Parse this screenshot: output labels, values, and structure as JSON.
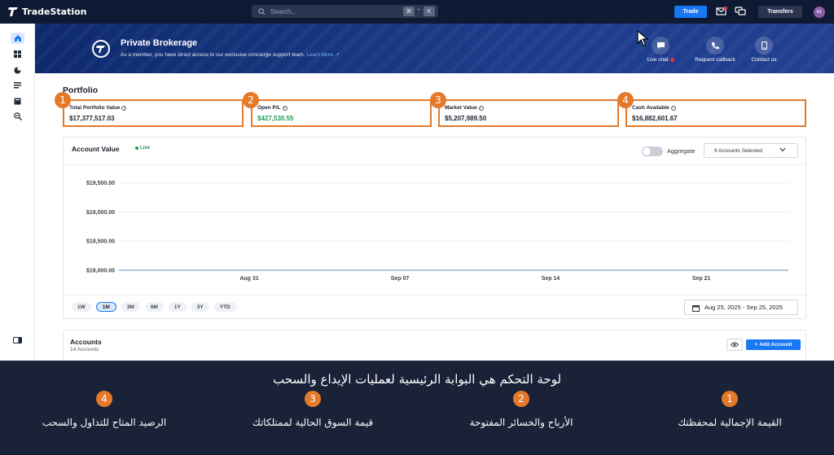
{
  "topbar": {
    "brand": "TradeStation",
    "search_placeholder": "Search...",
    "kbd_key1": "⌘",
    "kbd_plus": "+",
    "kbd_key2": "K",
    "trade_label": "Trade",
    "transfers_label": "Transfers",
    "avatar_initials": "ML"
  },
  "banner": {
    "title": "Private Brokerage",
    "subtitle": "As a member, you have direct access to our exclusive concierge support team.",
    "learn_more": "Learn More ↗",
    "actions": [
      {
        "label": "Live chat",
        "icon": "chat-icon"
      },
      {
        "label": "Request callback",
        "icon": "phone-icon"
      },
      {
        "label": "Contact us",
        "icon": "mobile-icon"
      }
    ]
  },
  "portfolio": {
    "title": "Portfolio",
    "stats": [
      {
        "badge": "1",
        "label": "Total Portfolio Value",
        "value": "$17,377,517.03",
        "green": false
      },
      {
        "badge": "2",
        "label": "Open P/L",
        "value": "$427,530.55",
        "green": true
      },
      {
        "badge": "3",
        "label": "Market Value",
        "value": "$5,207,989.50",
        "green": false
      },
      {
        "badge": "4",
        "label": "Cash Available",
        "value": "$16,882,601.67",
        "green": false
      }
    ]
  },
  "account_value": {
    "title": "Account Value",
    "live_label": "Live",
    "aggregate_label": "Aggregate",
    "accounts_selected": "9 Accounts Selected",
    "ranges": [
      "1W",
      "1M",
      "3M",
      "6M",
      "1Y",
      "3Y",
      "YTD"
    ],
    "active_range": "1M",
    "date_range": "Aug 25, 2025 - Sep 25, 2025"
  },
  "chart_data": {
    "type": "line",
    "title": "",
    "xlabel": "",
    "ylabel": "",
    "y_ticks": [
      18000,
      18500,
      19000,
      19500
    ],
    "y_tick_labels": [
      "$18,000.00",
      "$18,500.00",
      "$19,000.00",
      "$19,500.00"
    ],
    "ylim": [
      18000,
      19800
    ],
    "x_ticks": [
      "Aug 31",
      "Sep 07",
      "Sep 14",
      "Sep 21"
    ],
    "grid": true,
    "series": [
      {
        "values": [
          18000,
          18000
        ]
      }
    ]
  },
  "accounts": {
    "title": "Accounts",
    "count_label": "14 Accounts",
    "add_label": "Add Account"
  },
  "caption": {
    "title": "لوحة التحكم هي البوابة الرئيسية لعمليات الإيداع والسحب",
    "items": [
      {
        "badge": "1",
        "text": "القيمة الإجمالية لمحفظتك"
      },
      {
        "badge": "2",
        "text": "الأرباح والخسائر المفتوحة"
      },
      {
        "badge": "3",
        "text": "قيمة السوق الحالية لممتلكاتك"
      },
      {
        "badge": "4",
        "text": "الرصيد المتاح للتداول والسحب"
      }
    ]
  },
  "colors": {
    "accent": "#1877f2",
    "highlight": "#e4792a",
    "positive": "#1a9e55"
  }
}
